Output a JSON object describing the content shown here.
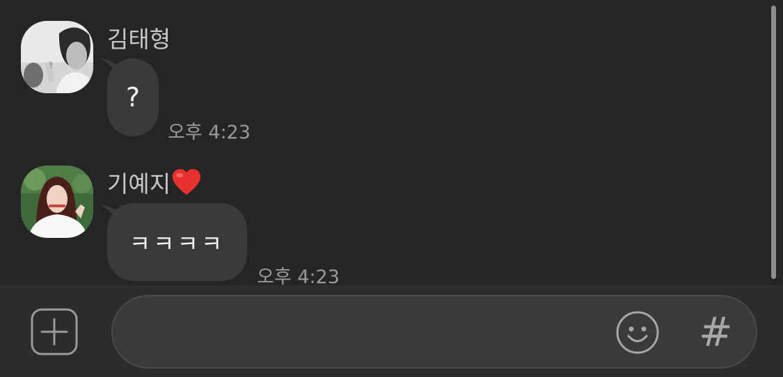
{
  "messages": [
    {
      "sender": "김태형",
      "avatar_icon": "user-avatar-grayscale",
      "text": "?",
      "time": "오후 4:23"
    },
    {
      "sender": "기예지",
      "sender_badge": "❤️",
      "avatar_icon": "user-avatar-color",
      "text": "ㅋㅋㅋㅋ",
      "time": "오후 4:23"
    }
  ],
  "input": {
    "placeholder": "",
    "value": "",
    "plus_icon": "plus-icon",
    "emoji_icon": "smiley-icon",
    "hash_label": "#"
  },
  "colors": {
    "background": "#252527",
    "bubble": "#3a3a3c",
    "input_bar": "#2c2c2e",
    "heart": "#e8312f"
  }
}
